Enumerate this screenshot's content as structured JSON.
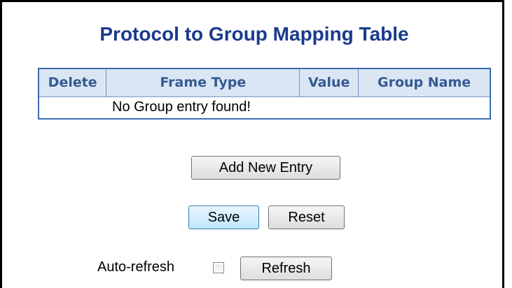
{
  "page": {
    "title": "Protocol to Group Mapping Table"
  },
  "table": {
    "columns": [
      "Delete",
      "Frame Type",
      "Value",
      "Group Name"
    ],
    "empty_message": "No Group entry found!"
  },
  "buttons": {
    "add_new_entry": "Add New Entry",
    "save": "Save",
    "reset": "Reset",
    "refresh": "Refresh"
  },
  "auto_refresh": {
    "label": "Auto-refresh",
    "checked": false
  },
  "colors": {
    "title": "#1a3a8c",
    "table_border": "#3a6ab0",
    "header_bg": "#dbe6f4",
    "header_text": "#355a92"
  }
}
